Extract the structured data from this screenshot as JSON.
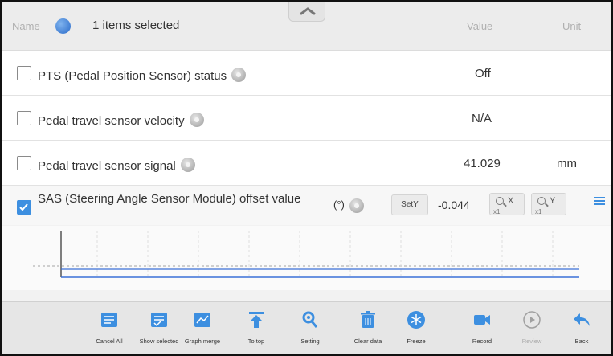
{
  "header": {
    "name_label": "Name",
    "selection_text": "1 items selected",
    "value_label": "Value",
    "unit_label": "Unit"
  },
  "rows": [
    {
      "label": "PTS (Pedal Position Sensor) status",
      "value": "Off",
      "unit": "",
      "checked": false
    },
    {
      "label": "Pedal travel sensor velocity",
      "value": "N/A",
      "unit": "",
      "checked": false
    },
    {
      "label": "Pedal travel sensor signal",
      "value": "41.029",
      "unit": "mm",
      "checked": false
    }
  ],
  "selected_row": {
    "label": "SAS (Steering Angle Sensor Module) offset value",
    "unit": "(°)",
    "sety_label": "SetY",
    "value": "-0.044",
    "zoom_x_label": "X",
    "zoom_x_sub": "x1",
    "zoom_y_label": "Y",
    "zoom_y_sub": "x1",
    "checked": true
  },
  "side_icons": [
    "menu-lines-icon",
    "fullscreen-icon",
    "close-icon"
  ],
  "graph": {
    "line_color": "#3a6fd8",
    "value": -0.044
  },
  "toolbar": {
    "items": [
      {
        "label": "Cancel All",
        "icon": "cancel-all-icon"
      },
      {
        "label": "Show selected",
        "icon": "show-selected-icon"
      },
      {
        "label": "Graph merge",
        "icon": "graph-merge-icon"
      },
      {
        "label": "To top",
        "icon": "to-top-icon"
      },
      {
        "label": "Setting",
        "icon": "setting-icon"
      },
      {
        "label": "Clear data",
        "icon": "clear-data-icon"
      },
      {
        "label": "Freeze",
        "icon": "freeze-icon"
      },
      {
        "label": "Record",
        "icon": "record-icon"
      },
      {
        "label": "Review",
        "icon": "review-icon",
        "disabled": true
      },
      {
        "label": "Back",
        "icon": "back-icon"
      }
    ]
  },
  "colors": {
    "accent": "#3d8fe0",
    "toolbar_icon": "#3d8fe0"
  }
}
